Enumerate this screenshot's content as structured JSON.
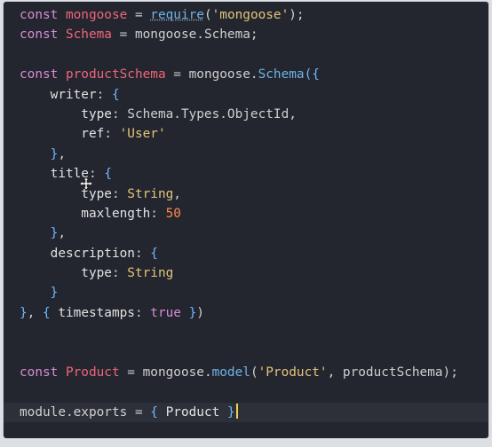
{
  "editor": {
    "lines": [
      {
        "tokens": [
          [
            "kw",
            "const "
          ],
          [
            "var",
            "mongoose"
          ],
          [
            "p",
            " = "
          ],
          [
            "fn req",
            "require"
          ],
          [
            "p",
            "("
          ],
          [
            "str",
            "'mongoose'"
          ],
          [
            "p",
            ");"
          ]
        ]
      },
      {
        "tokens": [
          [
            "kw",
            "const "
          ],
          [
            "var",
            "Schema"
          ],
          [
            "p",
            " = mongoose."
          ],
          [
            "p",
            "Schema;"
          ]
        ]
      },
      {
        "tokens": []
      },
      {
        "tokens": [
          [
            "kw",
            "const "
          ],
          [
            "var",
            "productSchema"
          ],
          [
            "p",
            " = mongoose."
          ],
          [
            "fn",
            "Schema"
          ],
          [
            "br",
            "({"
          ]
        ]
      },
      {
        "tokens": [
          [
            "prop",
            "    writer"
          ],
          [
            "p",
            ": "
          ],
          [
            "br",
            "{"
          ]
        ]
      },
      {
        "tokens": [
          [
            "prop",
            "        type"
          ],
          [
            "p",
            ": Schema.Types.ObjectId,"
          ]
        ]
      },
      {
        "tokens": [
          [
            "prop",
            "        ref"
          ],
          [
            "p",
            ": "
          ],
          [
            "str",
            "'User'"
          ]
        ]
      },
      {
        "tokens": [
          [
            "br",
            "    }"
          ],
          [
            "p",
            ","
          ]
        ]
      },
      {
        "tokens": [
          [
            "prop",
            "    title"
          ],
          [
            "p",
            ": "
          ],
          [
            "br",
            "{"
          ]
        ]
      },
      {
        "tokens": [
          [
            "prop",
            "        type"
          ],
          [
            "p",
            ": "
          ],
          [
            "str",
            "String"
          ],
          [
            "p",
            ","
          ]
        ]
      },
      {
        "tokens": [
          [
            "prop",
            "        maxlength"
          ],
          [
            "p",
            ": "
          ],
          [
            "num",
            "50"
          ]
        ]
      },
      {
        "tokens": [
          [
            "br",
            "    }"
          ],
          [
            "p",
            ","
          ]
        ]
      },
      {
        "tokens": [
          [
            "prop",
            "    description"
          ],
          [
            "p",
            ": "
          ],
          [
            "br",
            "{"
          ]
        ]
      },
      {
        "tokens": [
          [
            "prop",
            "        type"
          ],
          [
            "p",
            ": "
          ],
          [
            "str",
            "String"
          ]
        ]
      },
      {
        "tokens": [
          [
            "br",
            "    }"
          ]
        ]
      },
      {
        "tokens": [
          [
            "br",
            "}"
          ],
          [
            "p",
            ", "
          ],
          [
            "br",
            "{ "
          ],
          [
            "prop",
            "timestamps"
          ],
          [
            "p",
            ": "
          ],
          [
            "kw",
            "true"
          ],
          [
            "br",
            " }"
          ],
          [
            "p",
            ")"
          ]
        ]
      },
      {
        "tokens": []
      },
      {
        "tokens": []
      },
      {
        "tokens": [
          [
            "kw",
            "const "
          ],
          [
            "var",
            "Product"
          ],
          [
            "p",
            " = mongoose."
          ],
          [
            "fn",
            "model"
          ],
          [
            "p",
            "("
          ],
          [
            "str",
            "'Product'"
          ],
          [
            "p",
            ", productSchema);"
          ]
        ]
      },
      {
        "tokens": []
      },
      {
        "tokens": [
          [
            "p",
            "module.exports = "
          ],
          [
            "br",
            "{ "
          ],
          [
            "prop",
            "Product "
          ],
          [
            "br",
            "}"
          ]
        ],
        "cursor": true
      }
    ]
  },
  "colors": {
    "background": "#23262e",
    "keyword": "#d98bd6",
    "variable": "#f0657a",
    "function": "#6fb3e8",
    "string": "#e4c57a",
    "number": "#ff8a4c",
    "caret": "#f1d34a"
  },
  "icons": {
    "move_cursor": "move-cursor-icon"
  }
}
